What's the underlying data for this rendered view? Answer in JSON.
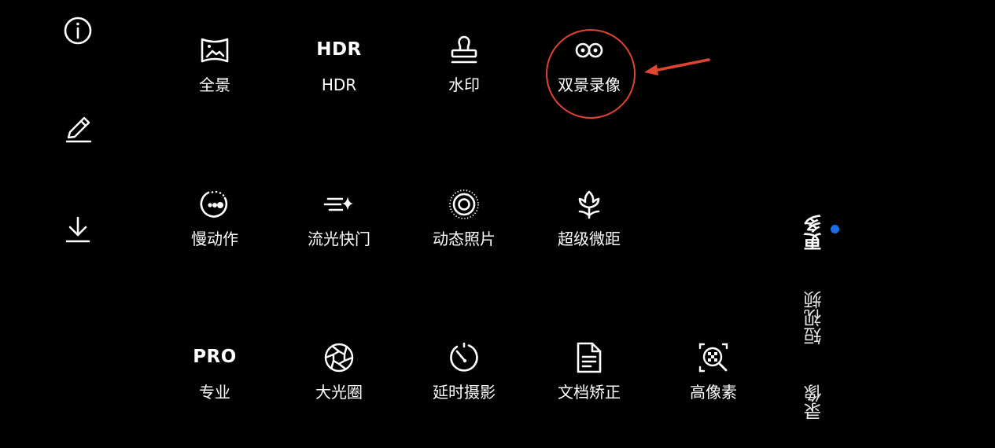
{
  "left_toolbar": {
    "icons": [
      "info-icon",
      "edit-icon",
      "download-icon"
    ]
  },
  "modes": {
    "row1": [
      {
        "label": "全景",
        "icon": "panorama-icon"
      },
      {
        "label": "HDR",
        "icon_text": "HDR"
      },
      {
        "label": "水印",
        "icon": "watermark-stamp-icon"
      },
      {
        "label": "双景录像",
        "icon": "dual-view-video-icon",
        "highlighted": true
      }
    ],
    "row2": [
      {
        "label": "慢动作",
        "icon": "slow-motion-icon"
      },
      {
        "label": "流光快门",
        "icon": "light-painting-icon"
      },
      {
        "label": "动态照片",
        "icon": "moving-picture-icon"
      },
      {
        "label": "超级微距",
        "icon": "super-macro-flower-icon"
      }
    ],
    "row3": [
      {
        "label": "专业",
        "icon_text": "PRO"
      },
      {
        "label": "大光圈",
        "icon": "aperture-icon"
      },
      {
        "label": "延时摄影",
        "icon": "time-lapse-icon"
      },
      {
        "label": "文档矫正",
        "icon": "document-correction-icon"
      },
      {
        "label": "高像素",
        "icon": "high-resolution-icon"
      }
    ]
  },
  "side_tabs": [
    {
      "label": "更多",
      "active": true
    },
    {
      "label": "短视频",
      "active": false
    },
    {
      "label": "录像",
      "active": false
    }
  ],
  "colors": {
    "background": "#000000",
    "annotation": "#e0452f",
    "active_dot": "#1a6fe6",
    "text": "#ffffff"
  }
}
